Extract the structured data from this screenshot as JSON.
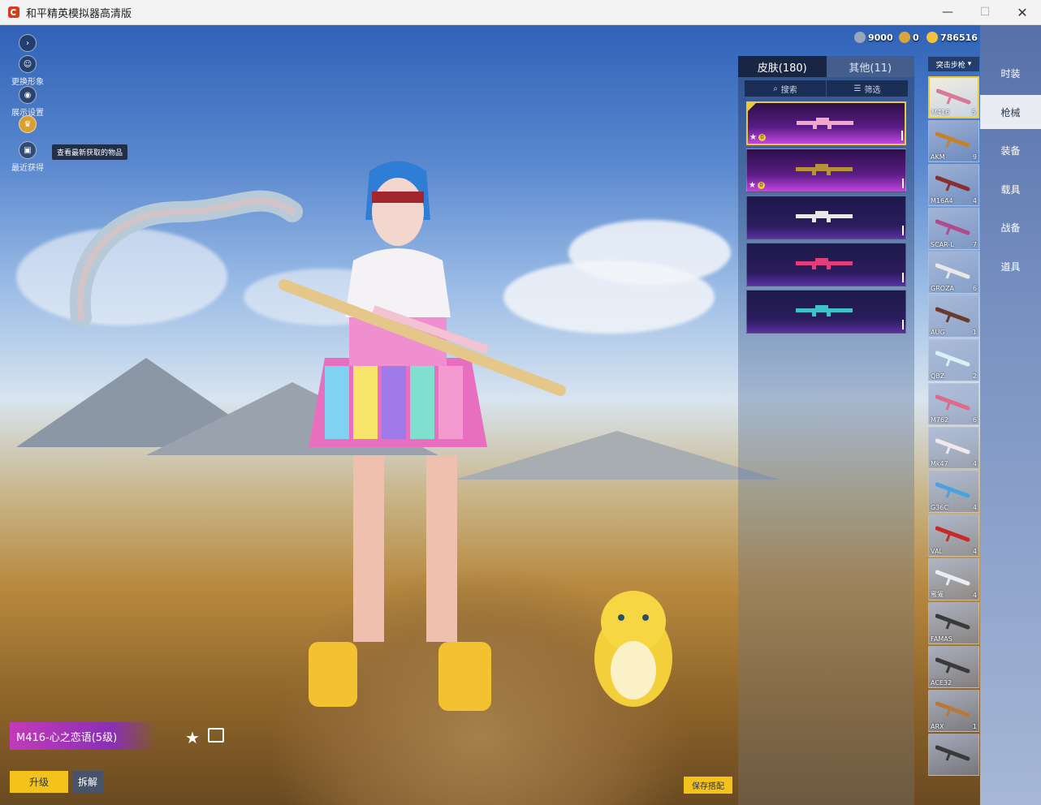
{
  "window": {
    "title": "和平精英模拟器高清版",
    "min": "—",
    "max": "☐",
    "close": "✕"
  },
  "left_tools": [
    {
      "label": "",
      "icon": "expand-arrow-icon"
    },
    {
      "label": "更换形象",
      "icon": "avatar-icon"
    },
    {
      "label": "展示设置",
      "icon": "eye-icon"
    },
    {
      "label": "",
      "icon": "badge-icon"
    },
    {
      "label": "最近获得",
      "icon": "gift-icon"
    }
  ],
  "tooltip": "查看最新获取的物品",
  "currency": [
    {
      "icon": "diamond-coin-icon",
      "value": "9000",
      "color": "#9aa6b8"
    },
    {
      "icon": "medal-coin-icon",
      "value": "0",
      "color": "#d7a53a"
    },
    {
      "icon": "gold-coin-icon",
      "value": "786516",
      "color": "#f2c23d"
    }
  ],
  "skin_panel": {
    "tab_skin": "皮肤(180)",
    "tab_other": "其他(11)",
    "search": "搜索",
    "filter": "筛选",
    "cards": [
      {
        "style": "purple",
        "selected": true,
        "badge": "0",
        "gun_color": "#f1a8c8"
      },
      {
        "style": "purple",
        "selected": false,
        "badge": "0",
        "gun_color": "#b8923a"
      },
      {
        "style": "dark",
        "selected": false,
        "badge": "",
        "gun_color": "#e8e8e8"
      },
      {
        "style": "dark",
        "selected": false,
        "badge": "",
        "gun_color": "#e0407a"
      },
      {
        "style": "dark",
        "selected": false,
        "badge": "",
        "gun_color": "#3ec1c9"
      }
    ]
  },
  "weapon_dropdown": "突击步枪",
  "weapons": [
    {
      "name": "M416",
      "count": "5",
      "selected": true,
      "color": "#d77a9a"
    },
    {
      "name": "AKM",
      "count": "9",
      "color": "#c4822b"
    },
    {
      "name": "M16A4",
      "count": "4",
      "color": "#8a2f2f"
    },
    {
      "name": "SCAR-L",
      "count": "7",
      "color": "#b04a8a"
    },
    {
      "name": "GROZA",
      "count": "6",
      "color": "#e8e8e8"
    },
    {
      "name": "AUG",
      "count": "1",
      "color": "#6a3a2a"
    },
    {
      "name": "QBZ",
      "count": "2",
      "color": "#d9f0f5"
    },
    {
      "name": "M762",
      "count": "6",
      "color": "#e06a8a"
    },
    {
      "name": "Mk47",
      "count": "4",
      "color": "#f0e8ec"
    },
    {
      "name": "G36C",
      "count": "4",
      "color": "#4aa3e0"
    },
    {
      "name": "VAL",
      "count": "4",
      "color": "#c82a2a"
    },
    {
      "name": "蜜獾",
      "count": "4",
      "color": "#e9eef5"
    },
    {
      "name": "FAMAS",
      "count": "",
      "color": "#3a3a3a"
    },
    {
      "name": "ACE32",
      "count": "",
      "color": "#3a3a3a"
    },
    {
      "name": "ARX",
      "count": "1",
      "color": "#b57a3a"
    },
    {
      "name": "",
      "count": "",
      "color": "#3a3a3a"
    }
  ],
  "categories": [
    {
      "label": "时装",
      "active": false
    },
    {
      "label": "枪械",
      "active": true
    },
    {
      "label": "装备",
      "active": false
    },
    {
      "label": "载具",
      "active": false
    },
    {
      "label": "战备",
      "active": false
    },
    {
      "label": "道具",
      "active": false
    }
  ],
  "bottom": {
    "weapon_title": "M416-心之恋语(5级)",
    "upgrade": "升级",
    "dismantle": "拆解",
    "save": "保存搭配"
  }
}
